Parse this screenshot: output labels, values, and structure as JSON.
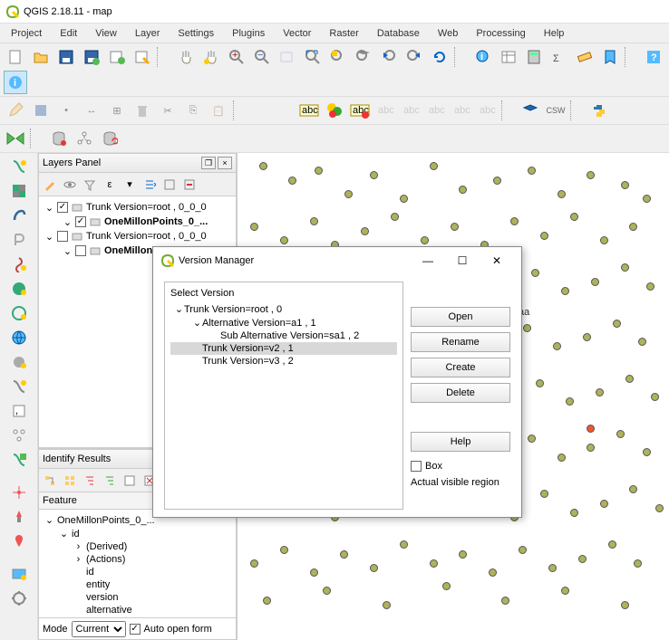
{
  "window": {
    "title": "QGIS 2.18.11 - map"
  },
  "menu": [
    "Project",
    "Edit",
    "View",
    "Layer",
    "Settings",
    "Plugins",
    "Vector",
    "Raster",
    "Database",
    "Web",
    "Processing",
    "Help"
  ],
  "layersPanel": {
    "title": "Layers Panel",
    "items": [
      {
        "label": "Trunk Version=root , 0_0_0",
        "checked": true,
        "indent": 0
      },
      {
        "label": "OneMillonPoints_0_...",
        "checked": true,
        "indent": 1,
        "bold": true
      },
      {
        "label": "Trunk Version=root , 0_0_0",
        "checked": false,
        "indent": 0
      },
      {
        "label": "OneMillonPointsbox...",
        "checked": false,
        "indent": 1,
        "bold": true
      }
    ]
  },
  "identify": {
    "title": "Identify Results",
    "featureLabel": "Feature",
    "rows": [
      "OneMillonPoints_0_...",
      "id",
      "(Derived)",
      "(Actions)",
      "id",
      "entity",
      "version",
      "alternative"
    ],
    "modeLabel": "Mode",
    "modeValue": "Current la",
    "autoOpen": "Auto open form"
  },
  "dialog": {
    "title": "Version Manager",
    "selectLabel": "Select Version",
    "tree": [
      {
        "label": "Trunk Version=root , 0",
        "indent": 0
      },
      {
        "label": "Alternative Version=a1 , 1",
        "indent": 1
      },
      {
        "label": "Sub Alternative Version=sa1 , 2",
        "indent": 2
      },
      {
        "label": "Trunk Version=v2 , 1",
        "indent": 1,
        "selected": true
      },
      {
        "label": "Trunk Version=v3 , 2",
        "indent": 1
      }
    ],
    "buttons": {
      "open": "Open",
      "rename": "Rename",
      "create": "Create",
      "delete": "Delete",
      "help": "Help"
    },
    "boxLabel": "Box",
    "regionLabel": "Actual visible region"
  },
  "annotation": "aa"
}
